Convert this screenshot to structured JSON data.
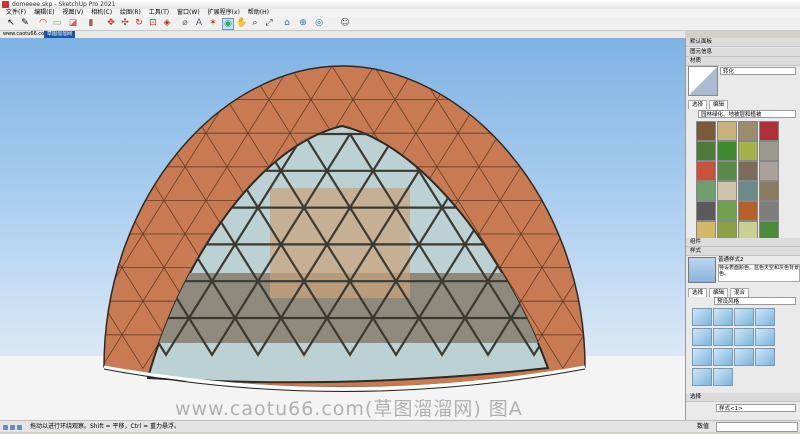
{
  "app": {
    "title": "domeeee.skp - SketchUp Pro 2021",
    "brand_color": "#c33"
  },
  "menu": [
    "文件(F)",
    "编辑(E)",
    "视图(V)",
    "相机(C)",
    "绘图(R)",
    "工具(T)",
    "窗口(W)",
    "扩展程序(x)",
    "帮助(H)"
  ],
  "toolbar": {
    "icons": [
      "select-icon",
      "pencil-icon",
      "arc-icon",
      "rectangle-icon",
      "eraser-icon",
      "paint-bucket-icon",
      "push-pull-icon",
      "move-icon",
      "rotate-icon",
      "scale-icon",
      "offset-icon",
      "tape-measure-icon",
      "text-icon",
      "axes-icon",
      "orbit-icon",
      "pan-icon",
      "zoom-icon",
      "zoom-extents-icon",
      "warehouse-icon",
      "extension-icon",
      "model-info-icon",
      "user-icon"
    ]
  },
  "tabs": {
    "site_label": "www.caotu66.com",
    "scene_label": "草图溜溜网"
  },
  "viewport": {
    "watermark": "www.caotu66.com(草图溜溜网) 图A",
    "colors": {
      "dome": "#c87a52",
      "glass": "#bcd1d3",
      "frame": "#3a3a30"
    }
  },
  "status": {
    "hint": "拖动以进行环绕观察。Shift = 平移，Ctrl = 重力悬浮。",
    "measure_label": "数值"
  },
  "panel": {
    "tray_title": "默认面板",
    "entity_info": "图元信息",
    "materials": {
      "title": "材质",
      "preview_label": "转化",
      "tab_select": "选择",
      "tab_edit": "编辑",
      "collection": "园林绿化、地被层和植被",
      "swatch_colors": [
        "#7a5a3c",
        "#c8b27a",
        "#9b8c6e",
        "#b0303a",
        "#4f7a3a",
        "#3e8a2e",
        "#a4b04c",
        "#9a9a8c",
        "#c9503a",
        "#5a8a4a",
        "#7a6b5a",
        "#a8a29a",
        "#6e9e6a",
        "#cfc5a8",
        "#6a8b8a",
        "#8a7a60",
        "#5a5a5a",
        "#6fa04a",
        "#b8602a",
        "#7d7d7d",
        "#d4b86a",
        "#8aa04a",
        "#c8d090",
        "#4a8a3a"
      ]
    },
    "components": "组件",
    "styles": {
      "title": "样式",
      "style_name": "普通样式2",
      "style_desc": "特设表面颜色。蓝色天空和灰色背景色。",
      "tab_select": "选择",
      "tab_edit": "编辑",
      "tab_mix": "混合",
      "collection": "预设风格",
      "thumbs": 14
    },
    "layers": {
      "tab_select": "选择",
      "collection": "样式<1>"
    }
  }
}
